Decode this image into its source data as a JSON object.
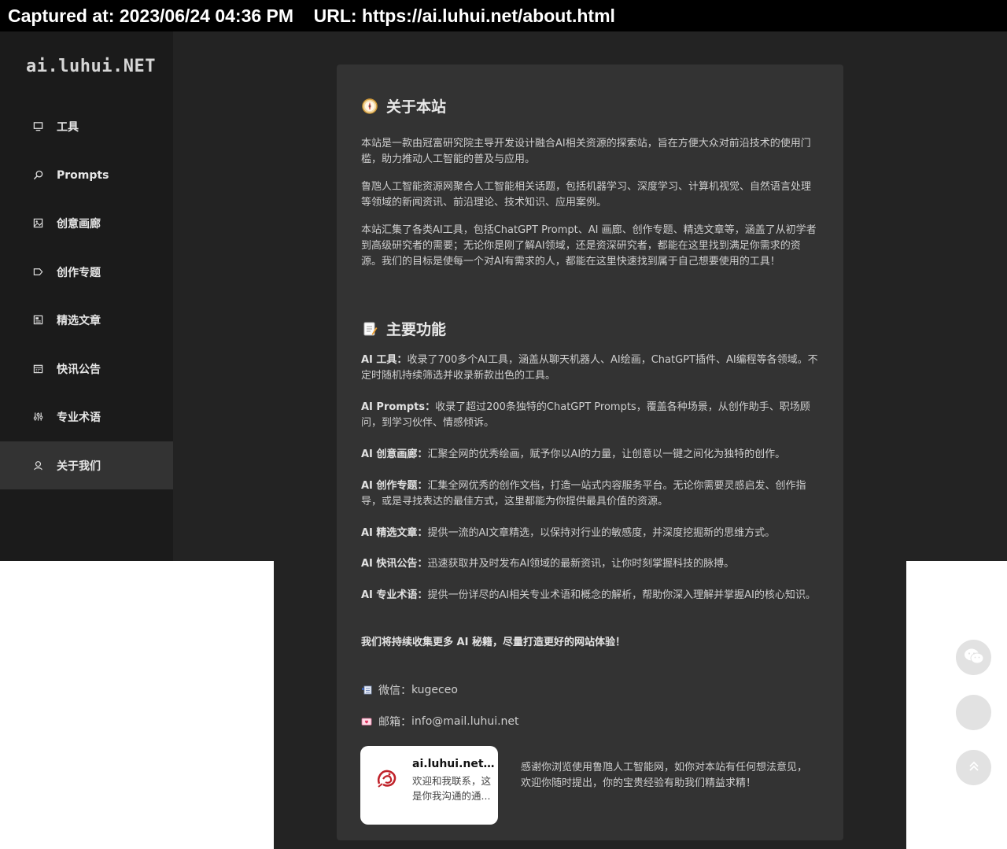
{
  "capture": {
    "text": "Captured at: 2023/06/24 04:36 PM    URL: https://ai.luhui.net/about.html"
  },
  "sidebar": {
    "logo": "ai.luhui.NET",
    "items": [
      {
        "label": "工具",
        "icon": "monitor-icon"
      },
      {
        "label": "Prompts",
        "icon": "search-icon"
      },
      {
        "label": "创意画廊",
        "icon": "image-icon"
      },
      {
        "label": "创作专题",
        "icon": "tag-icon"
      },
      {
        "label": "精选文章",
        "icon": "newspaper-icon"
      },
      {
        "label": "快讯公告",
        "icon": "calendar-icon"
      },
      {
        "label": "专业术语",
        "icon": "sliders-icon"
      },
      {
        "label": "关于我们",
        "icon": "user-icon",
        "active": true
      }
    ]
  },
  "about": {
    "title": "关于本站",
    "paragraphs": [
      "本站是一款由冠富研究院主导开发设计融合AI相关资源的探索站，旨在方便大众对前沿技术的使用门槛，助力推动人工智能的普及与应用。",
      "鲁虺人工智能资源网聚合人工智能相关话题，包括机器学习、深度学习、计算机视觉、自然语言处理等领域的新闻资讯、前沿理论、技术知识、应用案例。",
      "本站汇集了各类AI工具，包括ChatGPT Prompt、AI 画廊、创作专题、精选文章等，涵盖了从初学者到高级研究者的需要；无论你是刚了解AI领域，还是资深研究者，都能在这里找到满足你需求的资源。我们的目标是使每一个对AI有需求的人，都能在这里快速找到属于自己想要使用的工具！"
    ]
  },
  "features": {
    "title": "主要功能",
    "items": [
      {
        "label": "AI 工具：",
        "text": "收录了700多个AI工具，涵盖从聊天机器人、AI绘画，ChatGPT插件、AI编程等各领域。不定时随机持续筛选并收录新款出色的工具。"
      },
      {
        "label": "AI Prompts：",
        "text": "收录了超过200条独特的ChatGPT Prompts，覆盖各种场景，从创作助手、职场顾问，到学习伙伴、情感倾诉。"
      },
      {
        "label": "AI 创意画廊：",
        "text": "汇聚全网的优秀绘画，赋予你以AI的力量，让创意以一键之间化为独特的创作。"
      },
      {
        "label": "AI 创作专题：",
        "text": "汇集全网优秀的创作文档，打造一站式内容服务平台。无论你需要灵感启发、创作指导，或是寻找表达的最佳方式，这里都能为你提供最具价值的资源。"
      },
      {
        "label": "AI 精选文章：",
        "text": "提供一流的AI文章精选，以保持对行业的敏感度，并深度挖掘新的思维方式。"
      },
      {
        "label": "AI 快讯公告：",
        "text": "迅速获取并及时发布AI领域的最新资讯，让你时刻掌握科技的脉搏。"
      },
      {
        "label": "AI 专业术语：",
        "text": "提供一份详尽的AI相关专业术语和概念的解析，帮助你深入理解并掌握AI的核心知识。"
      }
    ],
    "closing": "我们将持续收集更多 AI 秘籍，尽量打造更好的网站体验！"
  },
  "contact": {
    "wechat_label": "微信：",
    "wechat_value": "kugeceo",
    "email_label": "邮箱：",
    "email_value": "info@mail.luhui.net"
  },
  "wx_card": {
    "name": "ai.luhui.net •...",
    "desc": "欢迎和我联系，这是你我沟通的通..."
  },
  "thanks": "感谢你浏览使用鲁虺人工智能网，如你对本站有任何想法意见，欢迎你随时提出，你的宝贵经验有助我们精益求精！"
}
